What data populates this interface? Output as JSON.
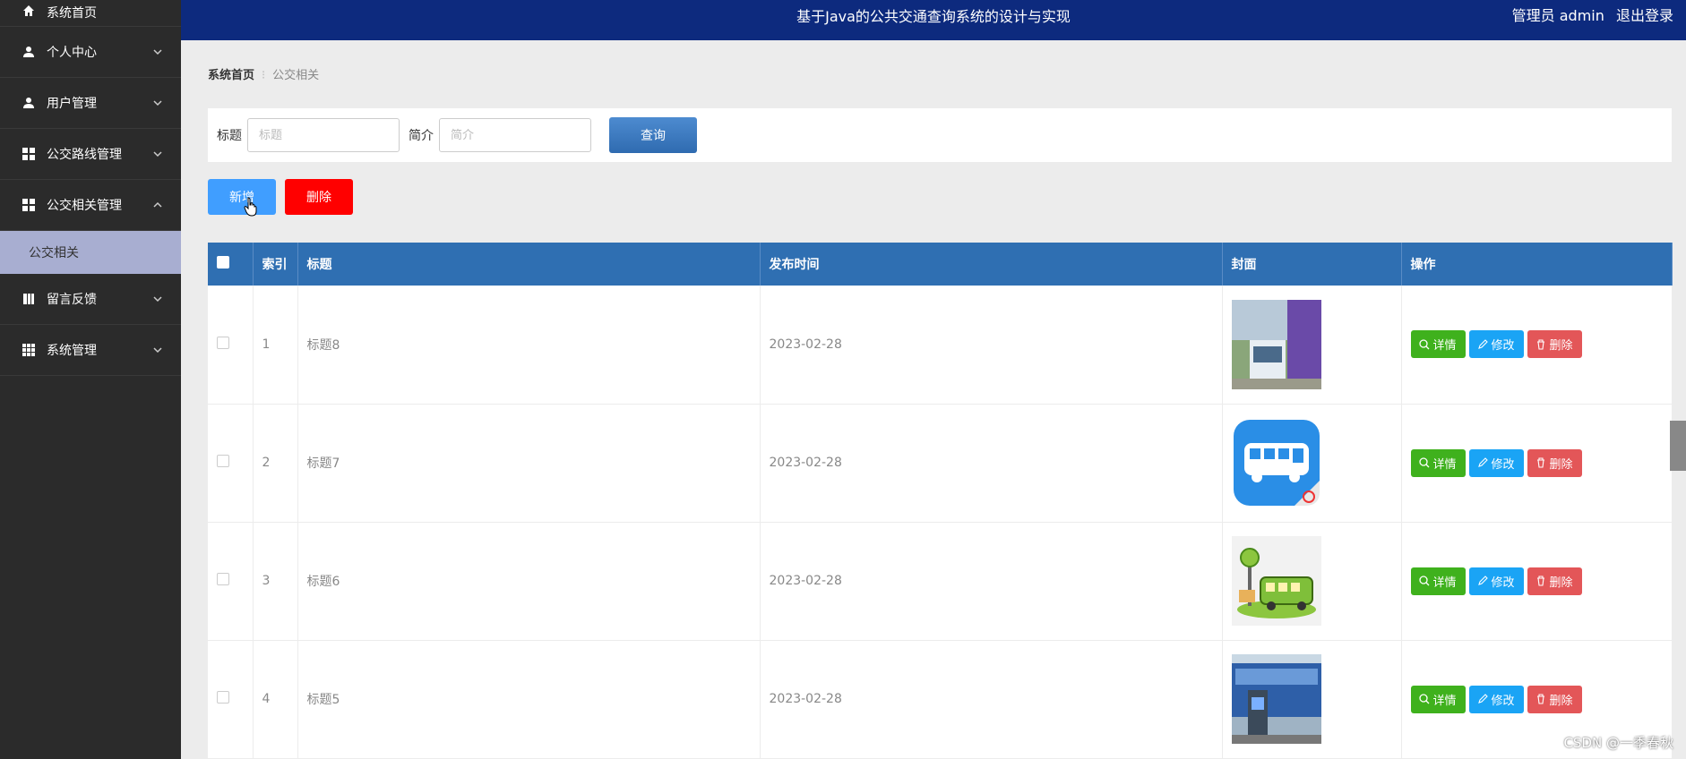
{
  "sidebar": {
    "items": [
      {
        "label": "系统首页",
        "icon": "home-icon"
      },
      {
        "label": "个人中心",
        "icon": "user-icon"
      },
      {
        "label": "用户管理",
        "icon": "user-icon"
      },
      {
        "label": "公交路线管理",
        "icon": "grid-icon"
      },
      {
        "label": "公交相关管理",
        "icon": "grid-icon"
      },
      {
        "label": "留言反馈",
        "icon": "book-icon"
      },
      {
        "label": "系统管理",
        "icon": "table-icon"
      }
    ],
    "sub_item": "公交相关"
  },
  "header": {
    "title": "基于Java的公共交通查询系统的设计与实现",
    "user": "管理员 admin",
    "logout": "退出登录"
  },
  "breadcrumb": {
    "home": "系统首页",
    "current": "公交相关"
  },
  "search": {
    "title_label": "标题",
    "title_placeholder": "标题",
    "intro_label": "简介",
    "intro_placeholder": "简介",
    "query_button": "查询"
  },
  "toolbar": {
    "add": "新增",
    "delete": "删除"
  },
  "table": {
    "headers": [
      "索引",
      "标题",
      "发布时间",
      "封面",
      "操作"
    ],
    "rows": [
      {
        "index": "1",
        "title": "标题8",
        "date": "2023-02-28"
      },
      {
        "index": "2",
        "title": "标题7",
        "date": "2023-02-28"
      },
      {
        "index": "3",
        "title": "标题6",
        "date": "2023-02-28"
      },
      {
        "index": "4",
        "title": "标题5",
        "date": "2023-02-28"
      }
    ],
    "actions": {
      "detail": "详情",
      "edit": "修改",
      "delete": "删除"
    }
  },
  "watermark": "CSDN @一季春秋",
  "colors": {
    "sidebar_bg": "#2b2b2b",
    "header_bg": "#0d2a7e",
    "table_header": "#2f6fb2",
    "add_btn": "#409eff",
    "delete_btn": "#ff0000",
    "detail_btn": "#3fb11d",
    "edit_btn": "#1aa4f5",
    "row_delete_btn": "#e35658"
  }
}
